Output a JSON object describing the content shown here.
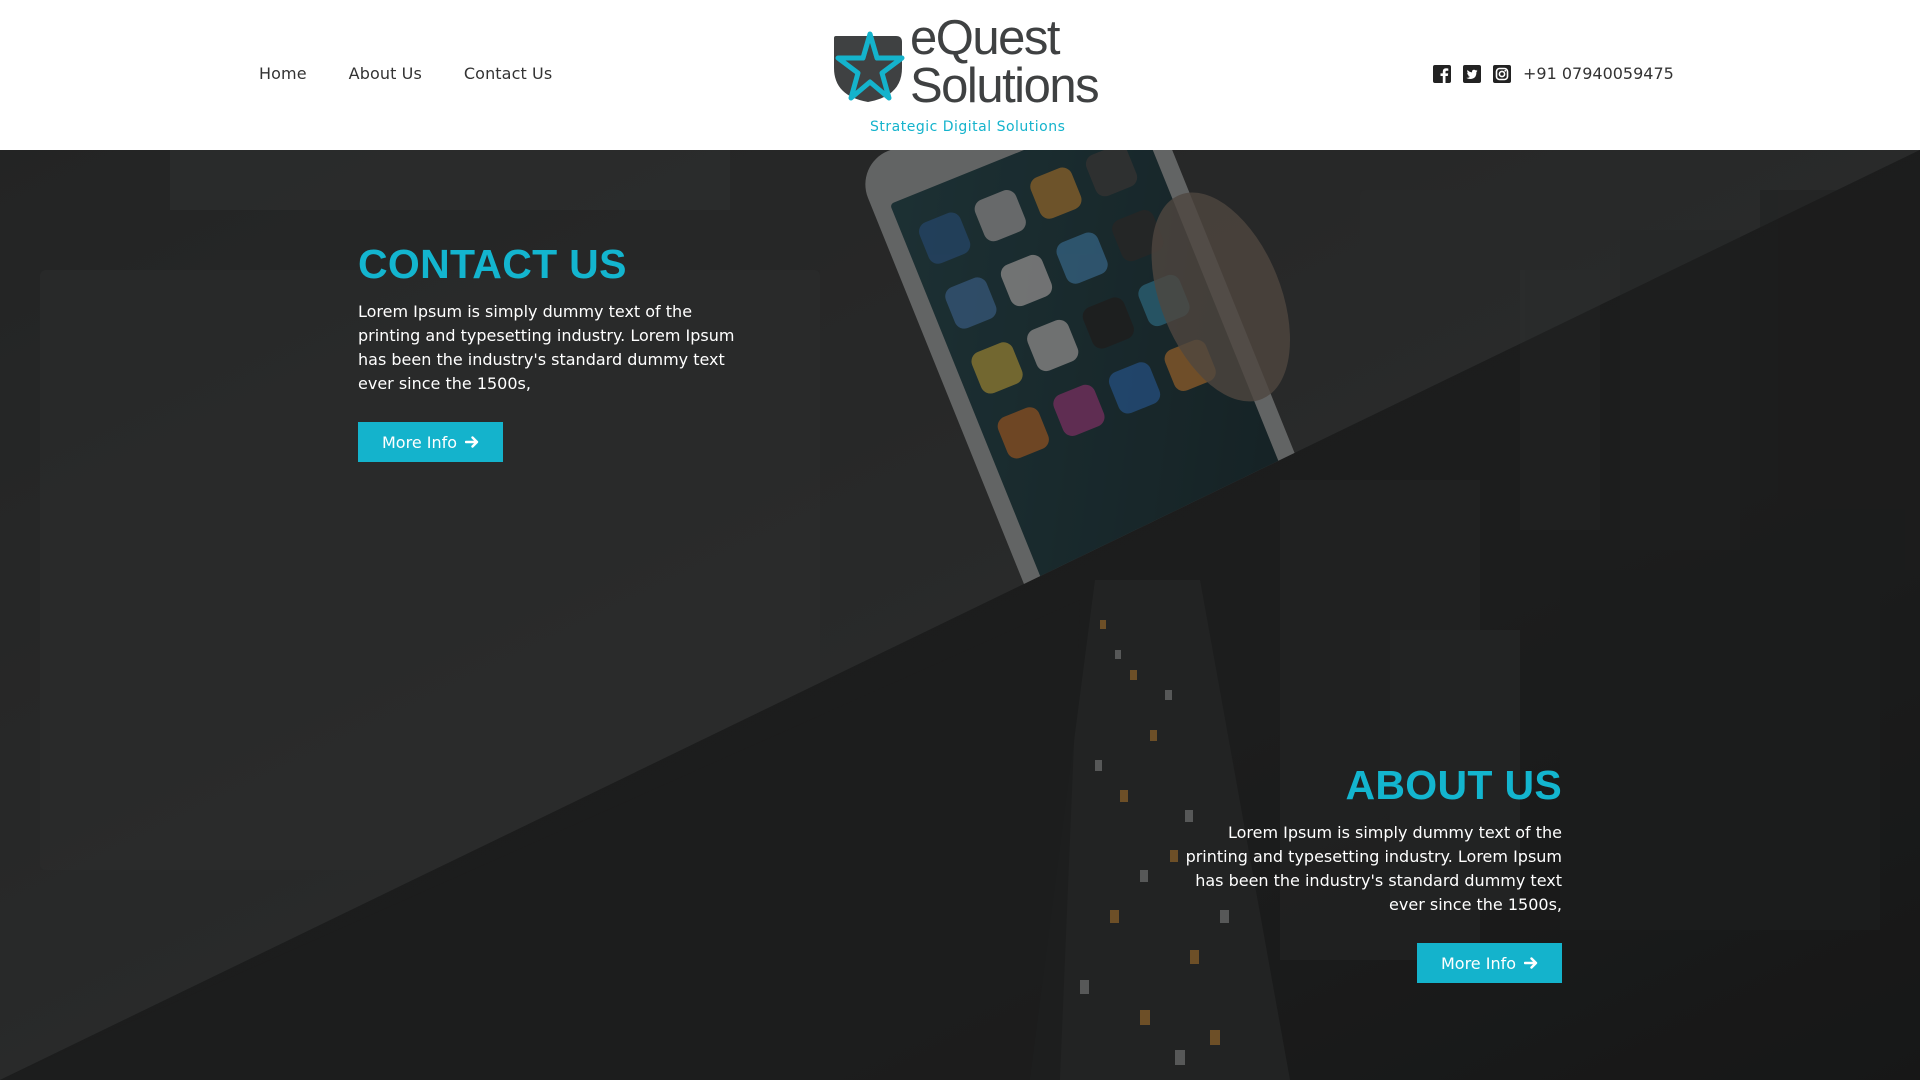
{
  "nav": {
    "items": [
      "Home",
      "About Us",
      "Contact Us"
    ]
  },
  "logo": {
    "line1": "eQuest",
    "line2": "Solutions",
    "tagline": "Strategic Digital Solutions"
  },
  "header_right": {
    "icons": [
      "facebook-icon",
      "twitter-icon",
      "instagram-icon"
    ],
    "phone": "+91 07940059475"
  },
  "contact_section": {
    "title": "CONTACT US",
    "body": "Lorem Ipsum is simply dummy text of the printing and typesetting industry. Lorem Ipsum has been the industry's standard dummy text ever since the 1500s,",
    "button_label": "More Info"
  },
  "about_section": {
    "title": "ABOUT US",
    "body": "Lorem Ipsum is simply dummy text of the printing and typesetting industry. Lorem Ipsum has been the industry's standard dummy text ever since the 1500s,",
    "button_label": "More Info"
  },
  "colors": {
    "accent": "#14b3cc",
    "header_bg": "#ffffff",
    "overlay": "#1b1c1c"
  }
}
